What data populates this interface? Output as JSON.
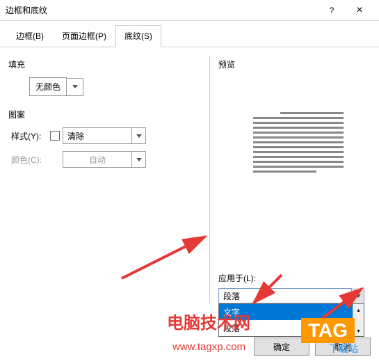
{
  "titlebar": {
    "title": "边框和底纹",
    "help": "?",
    "close": "×"
  },
  "tabs": [
    {
      "label": "边框(B)",
      "active": false
    },
    {
      "label": "页面边框(P)",
      "active": false
    },
    {
      "label": "底纹(S)",
      "active": true
    }
  ],
  "left": {
    "fill_label": "填充",
    "fill_value": "无颜色",
    "pattern_label": "图案",
    "style_label": "样式(Y):",
    "style_value": "清除",
    "color_label": "颜色(C):",
    "color_value": "自动"
  },
  "right": {
    "preview_label": "预览",
    "apply_label": "应用于(L):",
    "apply_value": "段落",
    "dropdown_options": [
      "文字",
      "段落"
    ]
  },
  "buttons": {
    "ok": "确定",
    "cancel": "取消"
  },
  "watermarks": {
    "site_cn": "电脑技术网",
    "site_url": "www.tagxp.com",
    "tag": "TAG",
    "tag_sub": "下载站"
  }
}
